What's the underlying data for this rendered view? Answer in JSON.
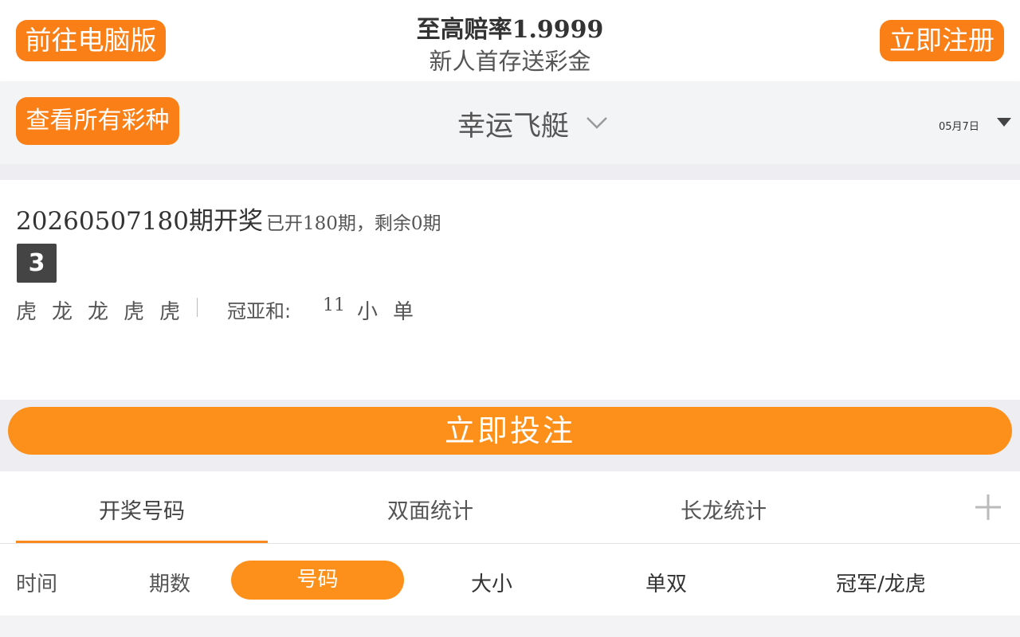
{
  "header": {
    "pc_version_label": "前往电脑版",
    "promo_title": "至高赔率1.9999",
    "promo_subtitle": "新人首存送彩金",
    "register_label": "立即注册"
  },
  "lottery_bar": {
    "all_lotteries_label": "查看所有彩种",
    "lottery_name": "幸运飞艇",
    "date": "05月7日"
  },
  "result": {
    "period": "20260507180",
    "period_suffix": "期开奖",
    "progress": "已开180期，剩余0期",
    "ball": "3",
    "dragon_tiger": [
      "虎",
      "龙",
      "龙",
      "虎",
      "虎"
    ],
    "sum_label": "冠亚和:",
    "sum_value": "11",
    "sum_size": "小",
    "sum_odd_even": "单"
  },
  "bet": {
    "label": "立即投注"
  },
  "tabs": {
    "numbers": "开奖号码",
    "two_sides": "双面统计",
    "long_dragon": "长龙统计",
    "active": "开奖号码"
  },
  "columns": {
    "time": "时间",
    "period": "期数",
    "number": "号码",
    "size": "大小",
    "odd_even": "单双",
    "champion_dt": "冠军/龙虎",
    "active": "号码"
  },
  "colors": {
    "accent": "#fb7f17",
    "bet_button": "#fd8f1b",
    "ball": "#444444"
  }
}
